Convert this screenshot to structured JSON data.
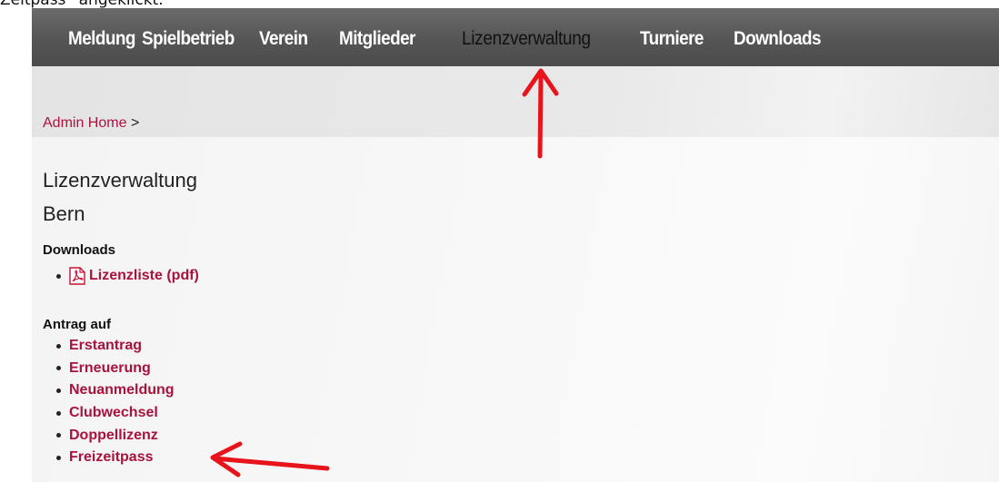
{
  "caption": "Zeitpass“ angeklickt.",
  "nav": {
    "items": [
      {
        "label": "Meldung"
      },
      {
        "label": "Spielbetrieb"
      },
      {
        "label": "Verein"
      },
      {
        "label": "Mitglieder"
      },
      {
        "label": "Lizenzverwaltung",
        "active": true
      },
      {
        "label": "Turniere"
      },
      {
        "label": "Downloads"
      }
    ]
  },
  "breadcrumb": {
    "home": "Admin Home",
    "separator": ">"
  },
  "page": {
    "title": "Lizenzverwaltung",
    "subtitle": "Bern"
  },
  "downloads": {
    "title": "Downloads",
    "items": [
      {
        "label": "Lizenzliste (pdf)",
        "icon": "pdf-icon"
      }
    ]
  },
  "antrag": {
    "title": "Antrag auf",
    "items": [
      {
        "label": "Erstantrag"
      },
      {
        "label": "Erneuerung"
      },
      {
        "label": "Neuanmeldung"
      },
      {
        "label": "Clubwechsel"
      },
      {
        "label": "Doppellizenz"
      },
      {
        "label": "Freizeitpass"
      }
    ]
  },
  "colors": {
    "link": "#a8123c",
    "navbar": "#585858",
    "annotation_arrow": "#e8141c"
  }
}
